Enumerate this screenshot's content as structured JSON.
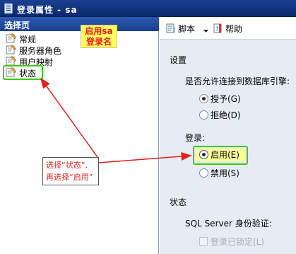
{
  "window": {
    "title": "登录属性 - sa",
    "title_icon": "window-icon"
  },
  "left_pane": {
    "header": "选择页",
    "items": [
      {
        "label": "常规",
        "icon": "page-wrench-icon"
      },
      {
        "label": "服务器角色",
        "icon": "page-wrench-icon"
      },
      {
        "label": "用户映射",
        "icon": "page-wrench-icon"
      },
      {
        "label": "状态",
        "icon": "page-wrench-icon"
      }
    ]
  },
  "annotations": {
    "top_callout": {
      "line1": "启用sa",
      "line2": "登录名"
    },
    "mid_callout": {
      "line1": "选择“状态”,",
      "line2": "再选择“启用”"
    },
    "highlight_color": "#3ccc10",
    "arrow_color": "#e41f1f"
  },
  "toolbar": {
    "script_label": "脚本",
    "script_icon": "script-icon",
    "dropdown_icon": "dropdown-arrow-icon",
    "help_label": "帮助",
    "help_icon": "help-icon"
  },
  "settings": {
    "section_title": "设置",
    "question": "是否允许连接到数据库引擎:",
    "grant_label": "授予(G)",
    "deny_label": "拒绝(D)",
    "grant_selected": true
  },
  "login": {
    "section_title": "登录:",
    "enable_label": "启用(E)",
    "disable_label": "禁用(S)",
    "enable_selected": true
  },
  "status": {
    "section_title": "状态",
    "auth_label": "SQL Server 身份验证:",
    "locked_label": "登录已锁定(L)",
    "locked_checked": false
  }
}
